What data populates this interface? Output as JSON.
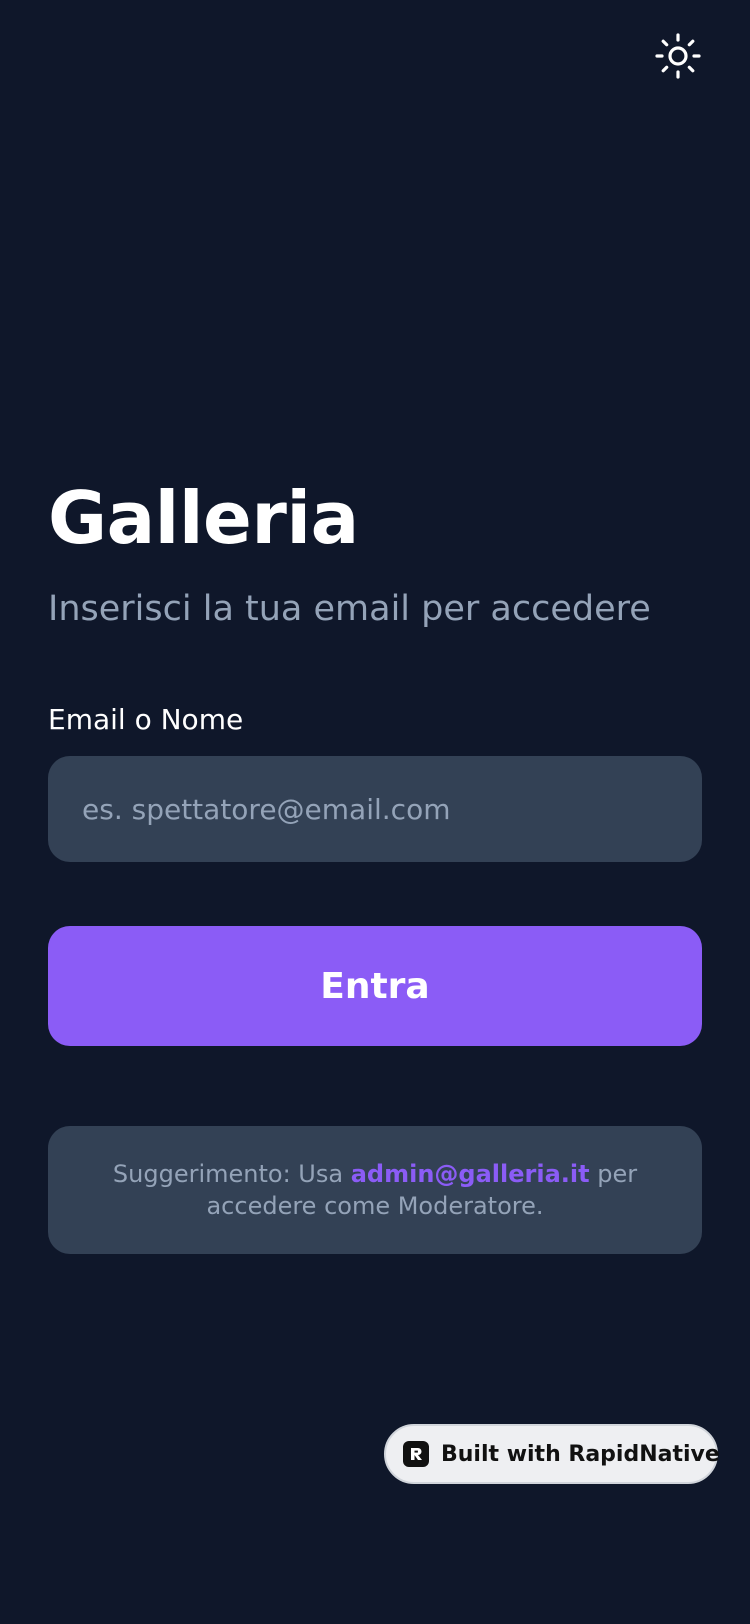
{
  "header": {
    "theme_icon": "sun-icon"
  },
  "login": {
    "title": "Galleria",
    "subtitle": "Inserisci la tua email per accedere",
    "field_label": "Email o Nome",
    "email_value": "",
    "email_placeholder": "es. spettatore@email.com",
    "submit_label": "Entra"
  },
  "hint": {
    "prefix": "Suggerimento: Usa ",
    "email": "admin@galleria.it",
    "suffix": " per accedere come Moderatore."
  },
  "badge": {
    "icon": "rapidnative-logo-icon",
    "label": "Built with RapidNative"
  },
  "colors": {
    "background": "#0f172a",
    "surface": "#334155",
    "accent": "#8b5cf6",
    "muted_text": "#94a3b8",
    "text": "#ffffff"
  }
}
